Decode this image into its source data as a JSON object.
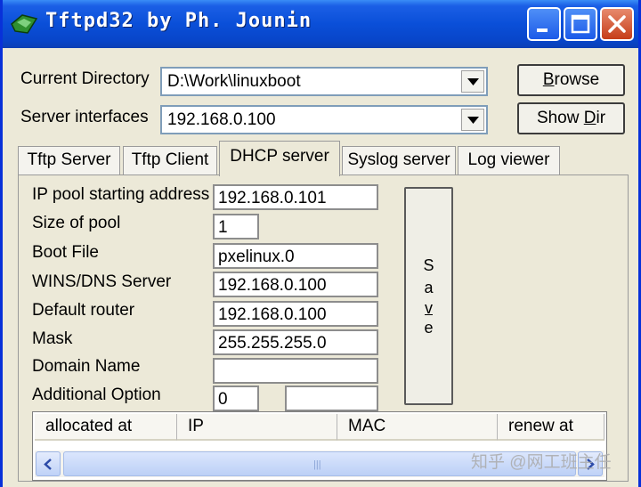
{
  "window": {
    "title": "Tftpd32 by Ph. Jounin"
  },
  "top": {
    "current_directory_label": "Current Directory",
    "current_directory_value": "D:\\Work\\linuxboot",
    "server_interfaces_label": "Server interfaces",
    "server_interfaces_value": "192.168.0.100",
    "browse_label": "rowse",
    "browse_mnemonic": "B",
    "show_dir_prefix": "Show ",
    "show_dir_mnemonic": "D",
    "show_dir_suffix": "ir"
  },
  "tabs": [
    {
      "label": "Tftp Server"
    },
    {
      "label": "Tftp Client"
    },
    {
      "label": "DHCP server"
    },
    {
      "label": "Syslog server"
    },
    {
      "label": "Log viewer"
    }
  ],
  "active_tab": "DHCP server",
  "dhcp": {
    "ip_pool_label": "IP pool starting address",
    "ip_pool_value": "192.168.0.101",
    "size_label": "Size of pool",
    "size_value": "1",
    "boot_file_label": "Boot File",
    "boot_file_value": "pxelinux.0",
    "wins_label": "WINS/DNS Server",
    "wins_value": "192.168.0.100",
    "router_label": "Default router",
    "router_value": "192.168.0.100",
    "mask_label": "Mask",
    "mask_value": "255.255.255.0",
    "domain_label": "Domain Name",
    "domain_value": "",
    "option_label": "Additional Option",
    "option_value": "0",
    "option_extra": "",
    "save_letters": [
      "S",
      "a",
      "v",
      "e"
    ]
  },
  "table": {
    "columns": [
      "allocated at",
      "IP",
      "MAC",
      "renew at"
    ],
    "scroll_grip": "|||"
  },
  "watermark": "知乎 @网工班主任",
  "colors": {
    "titlebar": "#0a4fd8",
    "window_bg": "#ece9d8",
    "border": "#0831d9"
  }
}
